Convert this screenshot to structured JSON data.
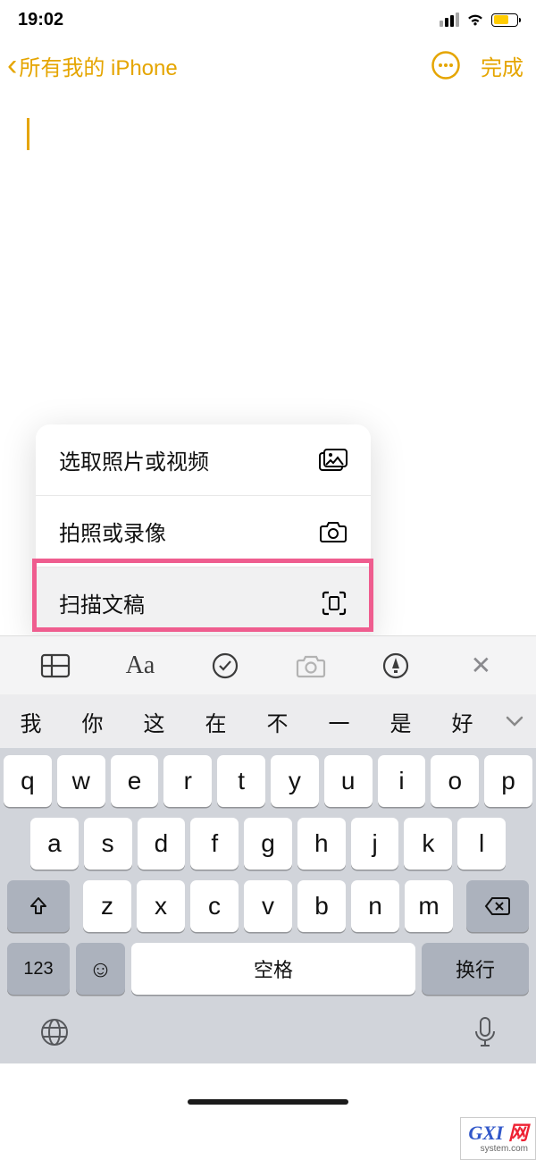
{
  "status": {
    "time": "19:02"
  },
  "nav": {
    "back": "所有我的 iPhone",
    "done": "完成"
  },
  "popup": {
    "items": [
      {
        "label": "选取照片或视频"
      },
      {
        "label": "拍照或录像"
      },
      {
        "label": "扫描文稿"
      }
    ]
  },
  "toolbar": {
    "aa": "Aa"
  },
  "suggestions": [
    "我",
    "你",
    "这",
    "在",
    "不",
    "一",
    "是",
    "好"
  ],
  "keys": {
    "r1": [
      "q",
      "w",
      "e",
      "r",
      "t",
      "y",
      "u",
      "i",
      "o",
      "p"
    ],
    "r2": [
      "a",
      "s",
      "d",
      "f",
      "g",
      "h",
      "j",
      "k",
      "l"
    ],
    "r3": [
      "z",
      "x",
      "c",
      "v",
      "b",
      "n",
      "m"
    ],
    "num": "123",
    "space": "空格",
    "ret": "换行"
  },
  "watermark": {
    "brand": "GXI",
    "suffix": "网",
    "url": "system.com"
  }
}
